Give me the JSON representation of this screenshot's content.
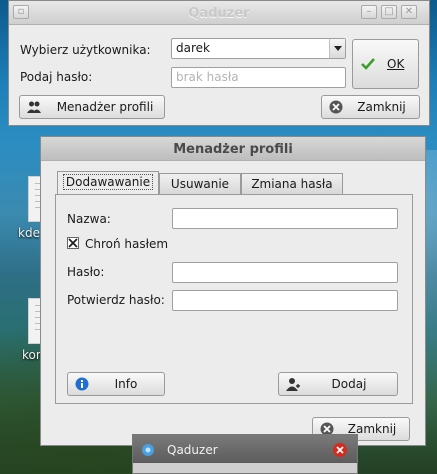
{
  "login_window": {
    "title": "Qaduzer",
    "user_label": "Wybierz użytkownika:",
    "user_value": "darek",
    "password_label": "Podaj hasło:",
    "password_placeholder": "brak hasła",
    "ok_label": "OK",
    "profiles_button_label": "Menadżer profili",
    "close_button_label": "Zamknij"
  },
  "profile_manager": {
    "title": "Menadżer profili",
    "tabs": [
      {
        "label": "Dodawawanie",
        "active": true
      },
      {
        "label": "Usuwanie",
        "active": false
      },
      {
        "label": "Zmiana hasła",
        "active": false
      }
    ],
    "name_label": "Nazwa:",
    "name_value": "",
    "protect_label": "Chroń hasłem",
    "protect_checked": true,
    "password_label": "Hasło:",
    "confirm_label": "Potwierdz hasło:",
    "info_button_label": "Info",
    "add_button_label": "Dodaj",
    "close_button_label": "Zamknij"
  },
  "desktop_icons": [
    {
      "label": "kde-"
    },
    {
      "label": "kon"
    }
  ],
  "third_window": {
    "title": "Qaduzer"
  },
  "colors": {
    "accent_check": "#3aa02a",
    "close_red": "#d42b1e",
    "info_blue": "#1f6fd1"
  }
}
